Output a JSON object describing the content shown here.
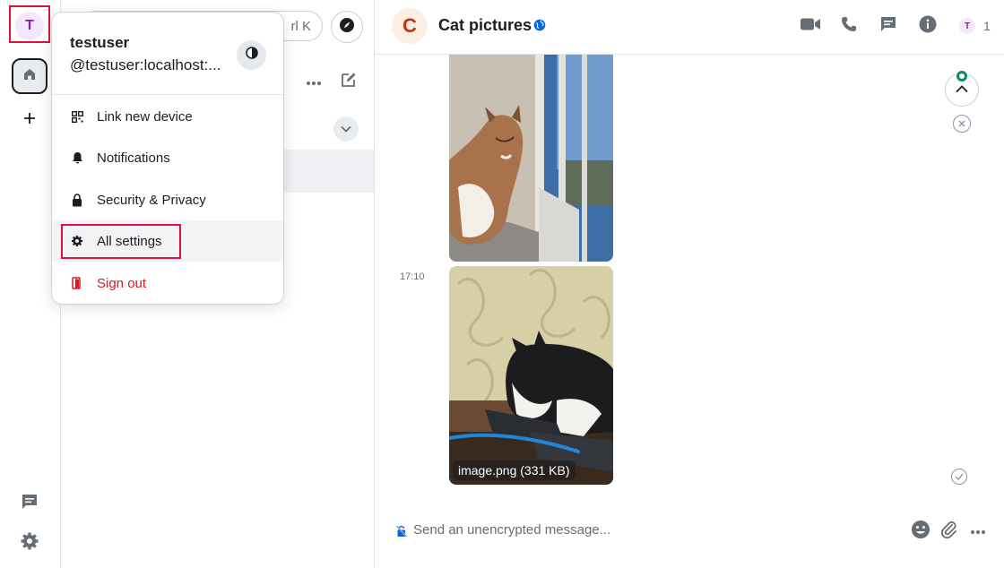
{
  "spacebar": {
    "user_initial": "T",
    "icons": [
      "home-icon",
      "plus-icon",
      "threads-icon",
      "settings-icon"
    ]
  },
  "roomlist": {
    "search_shortcut": "rl K"
  },
  "user_menu": {
    "display_name": "testuser",
    "user_id": "@testuser:localhost:...",
    "items": [
      {
        "label": "Link new device",
        "icon": "qr-code-icon"
      },
      {
        "label": "Notifications",
        "icon": "bell-icon"
      },
      {
        "label": "Security & Privacy",
        "icon": "lock-icon"
      },
      {
        "label": "All settings",
        "icon": "gear-icon"
      },
      {
        "label": "Sign out",
        "icon": "sign-out-icon"
      }
    ]
  },
  "room": {
    "avatar_initial": "C",
    "name": "Cat pictures",
    "member_initial": "T",
    "member_count": "1"
  },
  "timeline": {
    "timestamp": "17:10",
    "file_label": "image.png (331 KB)"
  },
  "composer": {
    "placeholder": "Send an unencrypted message..."
  },
  "colors": {
    "accent": "#0d8a63",
    "danger": "#d51928",
    "highlight": "#e0103b",
    "user_avatar": "#8c1f9c",
    "room_avatar": "#c4340f"
  }
}
